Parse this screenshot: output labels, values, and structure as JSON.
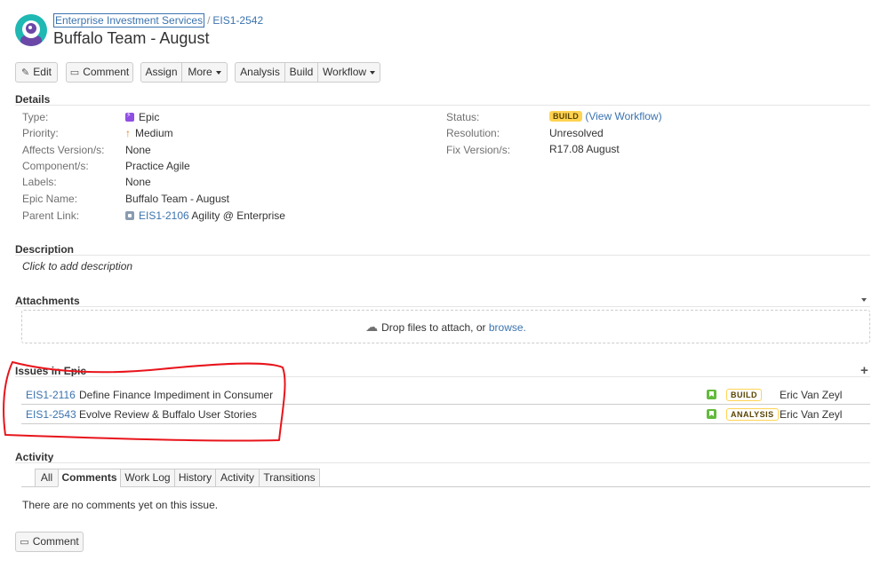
{
  "header": {
    "project_name": "Enterprise Investment Services",
    "separator": "/",
    "issue_key": "EIS1-2542",
    "title": "Buffalo Team - August"
  },
  "toolbar": {
    "edit_label": "Edit",
    "comment_label": "Comment",
    "assign_label": "Assign",
    "more_label": "More",
    "analysis_label": "Analysis",
    "build_label": "Build",
    "workflow_label": "Workflow"
  },
  "details": {
    "section_title": "Details",
    "type_label": "Type:",
    "type_value": "Epic",
    "priority_label": "Priority:",
    "priority_value": "Medium",
    "affects_label": "Affects Version/s:",
    "affects_value": "None",
    "component_label": "Component/s:",
    "component_value": "Practice Agile",
    "labels_label": "Labels:",
    "labels_value": "None",
    "epic_name_label": "Epic Name:",
    "epic_name_value": "Buffalo Team - August",
    "parent_label": "Parent Link:",
    "parent_key": "EIS1-2106",
    "parent_summary": "Agility @ Enterprise",
    "status_label": "Status:",
    "status_value": "BUILD",
    "view_workflow": "(View Workflow)",
    "resolution_label": "Resolution:",
    "resolution_value": "Unresolved",
    "fix_label": "Fix Version/s:",
    "fix_value": "R17.08 August"
  },
  "description": {
    "section_title": "Description",
    "placeholder": "Click to add description"
  },
  "attachments": {
    "section_title": "Attachments",
    "drop_text": "Drop files to attach, or ",
    "browse_link": "browse."
  },
  "issues_in_epic": {
    "section_title": "Issues in Epic",
    "rows": [
      {
        "key": "EIS1-2116",
        "summary": "Define Finance Impediment in Consumer",
        "status": "BUILD",
        "assignee": "Eric Van Zeyl"
      },
      {
        "key": "EIS1-2543",
        "summary": "Evolve Review & Buffalo User Stories",
        "status": "ANALYSIS",
        "assignee": "Eric Van Zeyl"
      }
    ]
  },
  "activity": {
    "section_title": "Activity",
    "tabs": [
      {
        "label": "All"
      },
      {
        "label": "Comments"
      },
      {
        "label": "Work Log"
      },
      {
        "label": "History"
      },
      {
        "label": "Activity"
      },
      {
        "label": "Transitions"
      }
    ],
    "active_tab": "Comments",
    "empty_text": "There are no comments yet on this issue.",
    "comment_button": "Comment"
  },
  "colors": {
    "link": "#3b73af",
    "status_yellow": "#ffd351",
    "epic_purple": "#904ee2",
    "story_green": "#63ba3c",
    "annotation_red": "#e8141b"
  },
  "icons": [
    "avatar",
    "pencil-icon",
    "comment-icon",
    "caret-down-icon",
    "epic-icon",
    "priority-medium-icon",
    "parent-link-icon",
    "cloud-upload-icon",
    "add-icon",
    "story-icon"
  ]
}
